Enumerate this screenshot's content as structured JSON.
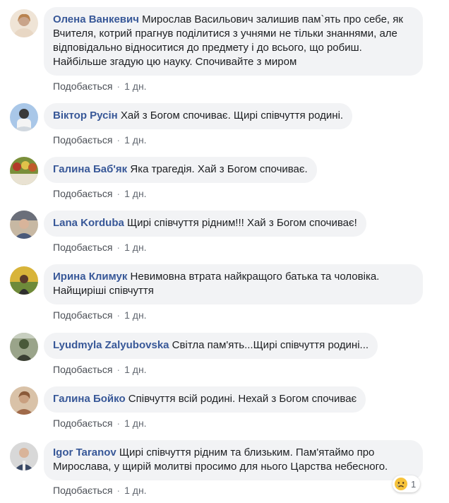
{
  "comments": [
    {
      "author": "Олена Ванкевич",
      "text": " Мирослав Васильович залишив пам`ять про себе, як Вчителя, котрий прагнув поділитися з учнями не тільки знаннями, але відповідально відноситися до предмету і до всього, що робиш. Найбільше згадую цю науку. Спочивайте з миром",
      "like_label": "Подобається",
      "time": "1 дн.",
      "avatar_colors": [
        "#c9a48a",
        "#efe4d6"
      ]
    },
    {
      "author": "Віктор Русін",
      "text": " Хай з Богом спочиває. Щирі співчуття родині.",
      "like_label": "Подобається",
      "time": "1 дн.",
      "avatar_colors": [
        "#3a3a3a",
        "#a9c7e8"
      ]
    },
    {
      "author": "Галина Баб'як",
      "text": " Яка трагедія. Хай з Богом спочиває.",
      "like_label": "Подобається",
      "time": "1 дн.",
      "avatar_colors": [
        "#b33a2a",
        "#7a8f3a"
      ]
    },
    {
      "author": "Lana Korduba",
      "text": " Щирі співчуття рідним!!! Хай з Богом спочиває!",
      "like_label": "Подобається",
      "time": "1 дн.",
      "avatar_colors": [
        "#6b6f7a",
        "#c7b8a3"
      ]
    },
    {
      "author": "Ирина Климук",
      "text": " Невимовна втрата найкращого батька та чоловіка. Найщиріші співчуття",
      "like_label": "Подобається",
      "time": "1 дн.",
      "avatar_colors": [
        "#d8b43a",
        "#6e8a3a"
      ]
    },
    {
      "author": "Lyudmyla Zalyubovska",
      "text": " Світла пам'ять...Щирі співчуття родині...",
      "like_label": "Подобається",
      "time": "1 дн.",
      "avatar_colors": [
        "#4a5a3a",
        "#9aa48a"
      ]
    },
    {
      "author": "Галина Бойко",
      "text": " Співчуття всій родині. Нехай з Богом спочиває",
      "like_label": "Подобається",
      "time": "1 дн.",
      "avatar_colors": [
        "#8a5a3a",
        "#d9c2a8"
      ]
    },
    {
      "author": "Igor Taranov",
      "text": " Щирі співчуття рідним та близьким. Пам'ятаймо про Мирослава, у щирій молитві просимо для нього Царства небесного.",
      "like_label": "Подобається",
      "time": "1 дн.",
      "avatar_colors": [
        "#3b4a66",
        "#d8d8d8"
      ]
    }
  ],
  "reaction": {
    "icon": "sad-reaction-icon",
    "count": "1"
  },
  "colors": {
    "author": "#385898",
    "bubble": "#f2f3f5",
    "meta": "#616770"
  }
}
